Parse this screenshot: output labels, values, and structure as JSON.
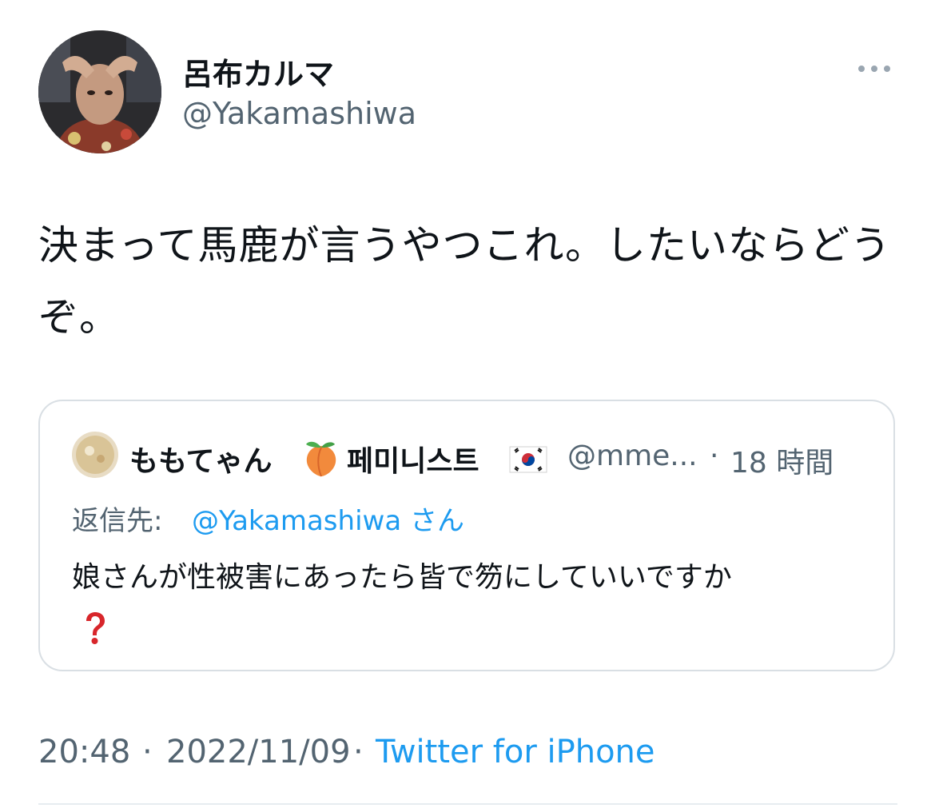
{
  "author": {
    "display_name": "呂布カルマ",
    "handle": "@Yakamashiwa"
  },
  "tweet": {
    "text": "決まって馬鹿が言うやつこれ。したいならどうぞ。"
  },
  "quoted_tweet": {
    "display_name": "ももてゃん",
    "display_name_suffix": "페미니스트",
    "handle": "@mme...",
    "separator": "·",
    "time_ago": "18 時間",
    "reply_label": "返信先:",
    "reply_to": "@Yakamashiwa さん",
    "text": "娘さんが性被害にあったら皆で笏にしていいですか",
    "emojis": [
      "peach-emoji",
      "south-korea-flag-emoji",
      "red-question-mark-emoji"
    ]
  },
  "meta": {
    "time": "20:48",
    "separator": "·",
    "date": "2022/11/09",
    "source": "Twitter for iPhone"
  },
  "colors": {
    "primary_text": "#0f1419",
    "secondary_text": "#536471",
    "link": "#1d9bf0",
    "border": "#d9dfe4"
  },
  "icons": {
    "more": "more-horizontal-icon"
  }
}
